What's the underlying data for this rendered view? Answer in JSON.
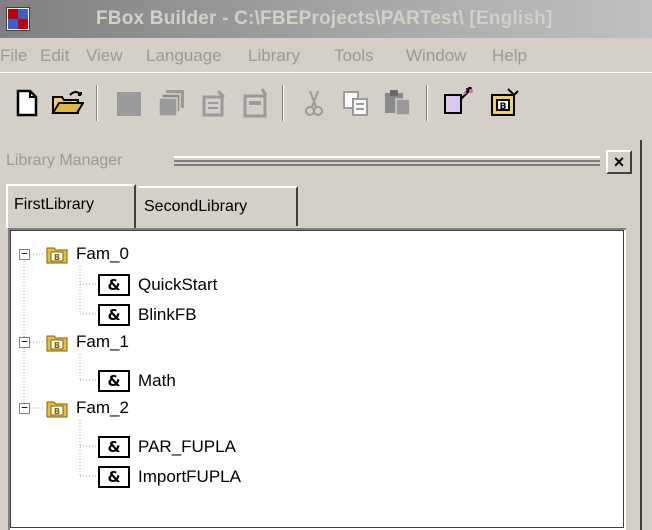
{
  "window": {
    "title": "FBox Builder - C:\\FBEProjects\\PARTest\\ [English]"
  },
  "menu": {
    "items": [
      "File",
      "Edit",
      "View",
      "Language",
      "Library",
      "Tools",
      "Window",
      "Help"
    ]
  },
  "toolbar": {
    "buttons": [
      "new-icon",
      "open-icon",
      "save-icon",
      "save-all-icon",
      "properties-icon",
      "document-icon",
      "cut-icon",
      "copy-icon",
      "paste-icon",
      "fbox-wizard-icon",
      "library-icon"
    ]
  },
  "library_manager": {
    "title": "Library Manager",
    "close_label": "×",
    "tabs": [
      {
        "label": "FirstLibrary",
        "active": true
      },
      {
        "label": "SecondLibrary",
        "active": false
      }
    ],
    "tree": [
      {
        "label": "Fam_0",
        "expander": "−",
        "children": [
          {
            "label": "QuickStart",
            "icon_text": "&"
          },
          {
            "label": "BlinkFB",
            "icon_text": "&"
          }
        ]
      },
      {
        "label": "Fam_1",
        "expander": "−",
        "children": [
          {
            "label": "Math",
            "icon_text": "&"
          }
        ]
      },
      {
        "label": "Fam_2",
        "expander": "−",
        "children": [
          {
            "label": "PAR_FUPLA",
            "icon_text": "&"
          },
          {
            "label": "ImportFUPLA",
            "icon_text": "&"
          }
        ]
      }
    ]
  },
  "colors": {
    "disabled_text": "#9a9a9a",
    "face": "#d4d0c8",
    "folder": "#e8c040"
  }
}
